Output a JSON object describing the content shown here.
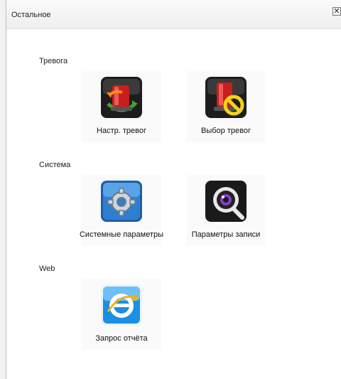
{
  "window": {
    "title": "Остальное",
    "close_glyph": "✕"
  },
  "sections": [
    {
      "title": "Тревога",
      "items": [
        {
          "label": "Настр. тревог",
          "icon": "alarm-settings-icon"
        },
        {
          "label": "Выбор тревог",
          "icon": "alarm-select-icon"
        }
      ]
    },
    {
      "title": "Система",
      "items": [
        {
          "label": "Системные параметры",
          "icon": "system-gear-icon"
        },
        {
          "label": "Параметры записи",
          "icon": "recording-camera-icon"
        }
      ]
    },
    {
      "title": "Web",
      "items": [
        {
          "label": "Запрос отчёта",
          "icon": "report-browser-icon"
        }
      ]
    }
  ],
  "colors": {
    "alarm_red": "#c81e1e",
    "arrow_green": "#3fa535",
    "arrow_orange": "#ff8c1a",
    "prohibit_yellow": "#f4d21b",
    "gear_blue": "#2f7fd1",
    "ie_blue": "#1b8fe2"
  }
}
